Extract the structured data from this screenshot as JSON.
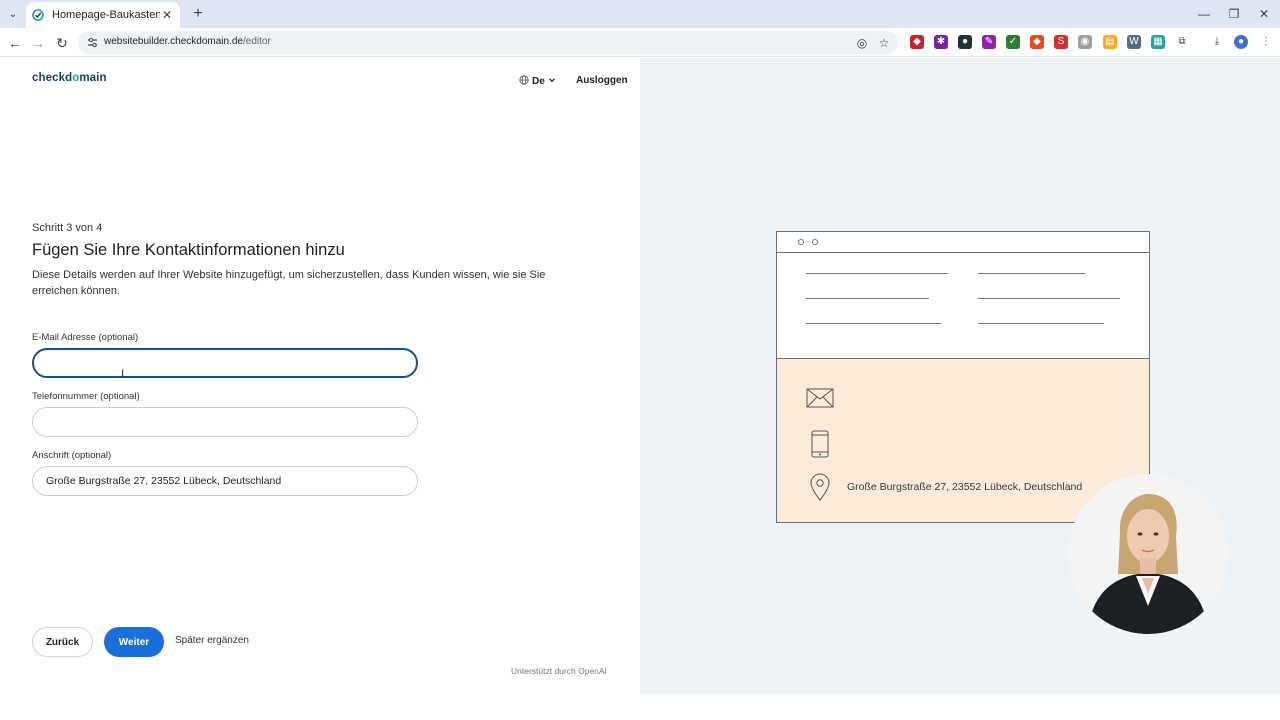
{
  "browser": {
    "tab_title": "Homepage-Baukasten",
    "url_host": "websitebuilder.checkdomain.de",
    "url_path": "/editor"
  },
  "header": {
    "logo_text_1": "checkd",
    "logo_text_accent": "o",
    "logo_text_2": "main",
    "language": "De",
    "logout_label": "Ausloggen"
  },
  "form": {
    "step_label": "Schritt 3 von 4",
    "title": "Fügen Sie Ihre Kontaktinformationen hinzu",
    "description": "Diese Details werden auf Ihrer Website hinzugefügt, um sicherzustellen, dass Kunden wissen, wie sie Sie erreichen können.",
    "email_label": "E-Mail Adresse (optional)",
    "email_value": "",
    "phone_label": "Telefonnummer (optional)",
    "phone_value": "",
    "address_label": "Anschrift (optional)",
    "address_value": "Große Burgstraße 27, 23552 Lübeck, Deutschland"
  },
  "actions": {
    "back_label": "Zurück",
    "next_label": "Weiter",
    "later_label": "Später ergänzen"
  },
  "footer": {
    "powered_by": "Unterstützt durch OpenAI"
  },
  "preview": {
    "address": "Große Burgstraße 27, 23552 Lübeck, Deutschland"
  },
  "colors": {
    "primary_button": "#1a6ed8",
    "focus_border": "#1a4f8b",
    "preview_background": "#edf3f7",
    "contact_block": "#fdebd9"
  }
}
